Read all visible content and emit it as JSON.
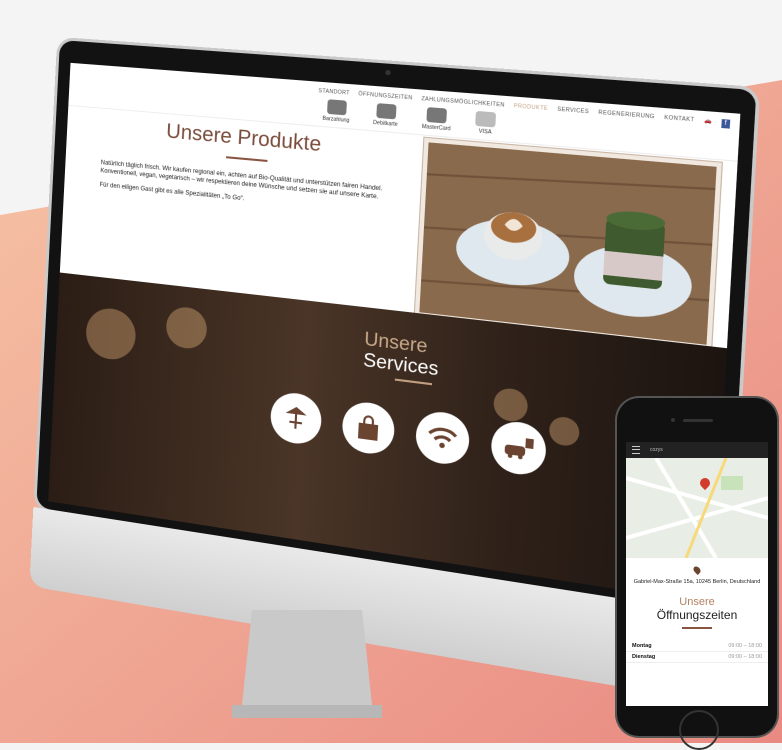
{
  "colors": {
    "accent_brown": "#7a4c3b",
    "accent_tan": "#c4a486",
    "background_peach": "#eea08d"
  },
  "desktop": {
    "nav": [
      "STANDORT",
      "ÖFFNUNGSZEITEN",
      "ZAHLUNGSMÖGLICHKEITEN",
      "PRODUKTE",
      "SERVICES",
      "REGENERIERUNG",
      "KONTAKT"
    ],
    "nav_active": "PRODUKTE",
    "payment": [
      {
        "label": "Barzahlung",
        "icon": "cash-icon"
      },
      {
        "label": "Debitkarte",
        "icon": "debit-card-icon"
      },
      {
        "label": "MasterCard",
        "icon": "mastercard-icon"
      },
      {
        "label": "VISA",
        "icon": "visa-icon"
      }
    ],
    "products": {
      "title": "Unsere Produkte",
      "text1": "Natürlich täglich frisch. Wir kaufen regional ein, achten auf Bio-Qualität und unterstützen fairen Handel. Konventionell, vegan, vegetarisch – wir respektieren deine Wünsche und setzen sie auf unsere Karte.",
      "text2": "Für den eiligen Gast gibt es alle Spezialitäten „To Go“."
    },
    "services": {
      "title_line1": "Unsere",
      "title_line2": "Services",
      "icons": [
        "terrace-icon",
        "shopping-bag-icon",
        "wifi-icon",
        "parking-icon"
      ]
    }
  },
  "phone": {
    "nav_logo": "cozys",
    "address": "Gabriel-Max-Straße 15a, 10245 Berlin, Deutschland",
    "hours_title1": "Unsere",
    "hours_title2": "Öffnungszeiten",
    "hours": [
      {
        "day": "Montag",
        "time": "09:00 – 18:00"
      },
      {
        "day": "Dienstag",
        "time": "09:00 – 18:00"
      }
    ]
  }
}
